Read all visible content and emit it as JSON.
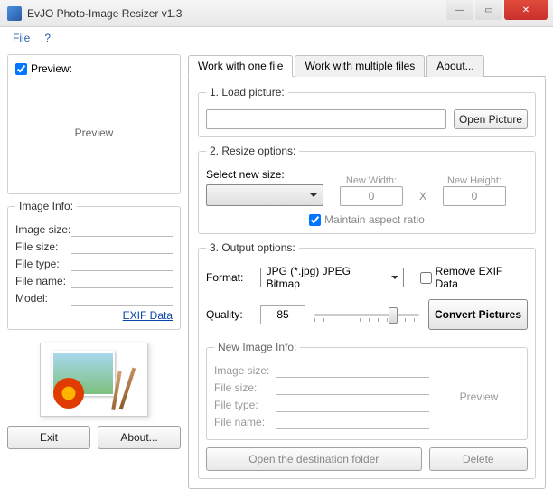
{
  "window": {
    "title": "EvJO Photo-Image Resizer v1.3"
  },
  "menu": {
    "file": "File",
    "help": "?"
  },
  "left": {
    "preview_check_label": "Preview:",
    "preview_placeholder": "Preview",
    "image_info_legend": "Image Info:",
    "labels": {
      "image_size": "Image size:",
      "file_size": "File size:",
      "file_type": "File type:",
      "file_name": "File name:",
      "model": "Model:"
    },
    "exif_link": "EXIF Data",
    "exit_btn": "Exit",
    "about_btn": "About..."
  },
  "tabs": {
    "one": "Work with one file",
    "multi": "Work with multiple files",
    "about": "About..."
  },
  "section1": {
    "title": "1. Load picture:",
    "open_btn": "Open Picture"
  },
  "section2": {
    "title": "2. Resize options:",
    "select_label": "Select new size:",
    "new_width": "New Width:",
    "new_height": "New Height:",
    "width_val": "0",
    "height_val": "0",
    "x": "X",
    "maintain": "Maintain aspect ratio"
  },
  "section3": {
    "title": "3. Output options:",
    "format_label": "Format:",
    "format_value": "JPG (*.jpg) JPEG Bitmap",
    "remove_exif": "Remove EXIF Data",
    "quality_label": "Quality:",
    "quality_value": "85",
    "convert_btn": "Convert Pictures"
  },
  "new_info": {
    "legend": "New Image Info:",
    "labels": {
      "image_size": "Image size:",
      "file_size": "File size:",
      "file_type": "File type:",
      "file_name": "File name:"
    },
    "preview": "Preview",
    "open_dest": "Open the destination folder",
    "delete": "Delete"
  }
}
